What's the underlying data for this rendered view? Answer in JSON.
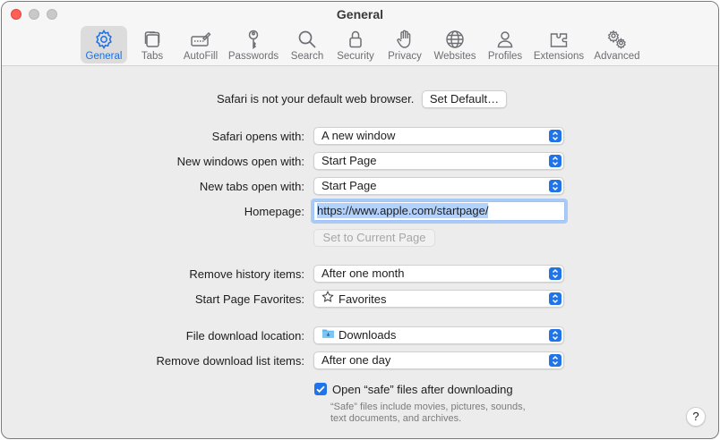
{
  "window": {
    "title": "General"
  },
  "toolbar": {
    "items": [
      {
        "label": "General",
        "icon": "gear-icon",
        "active": true
      },
      {
        "label": "Tabs",
        "icon": "tabs-icon"
      },
      {
        "label": "AutoFill",
        "icon": "autofill-icon"
      },
      {
        "label": "Passwords",
        "icon": "key-icon"
      },
      {
        "label": "Search",
        "icon": "magnifier-icon"
      },
      {
        "label": "Security",
        "icon": "lock-icon"
      },
      {
        "label": "Privacy",
        "icon": "hand-icon"
      },
      {
        "label": "Websites",
        "icon": "globe-icon"
      },
      {
        "label": "Profiles",
        "icon": "person-icon"
      },
      {
        "label": "Extensions",
        "icon": "puzzle-icon"
      },
      {
        "label": "Advanced",
        "icon": "gears-icon"
      }
    ]
  },
  "default_browser": {
    "message": "Safari is not your default web browser.",
    "button": "Set Default…"
  },
  "settings": {
    "opens_with": {
      "label": "Safari opens with:",
      "value": "A new window"
    },
    "new_windows": {
      "label": "New windows open with:",
      "value": "Start Page"
    },
    "new_tabs": {
      "label": "New tabs open with:",
      "value": "Start Page"
    },
    "homepage": {
      "label": "Homepage:",
      "value": "https://www.apple.com/startpage/"
    },
    "set_current": {
      "label": "Set to Current Page"
    },
    "remove_history": {
      "label": "Remove history items:",
      "value": "After one month"
    },
    "favorites": {
      "label": "Start Page Favorites:",
      "value": "Favorites"
    },
    "download_location": {
      "label": "File download location:",
      "value": "Downloads"
    },
    "remove_downloads": {
      "label": "Remove download list items:",
      "value": "After one day"
    },
    "open_safe": {
      "label": "Open “safe” files after downloading",
      "checked": true,
      "note_line1": "“Safe” files include movies, pictures, sounds,",
      "note_line2": "text documents, and archives."
    }
  },
  "help": {
    "label": "?"
  },
  "colors": {
    "accent": "#1f74ea",
    "active_tab": "#1c6fe0",
    "window_bg": "#ececec"
  }
}
